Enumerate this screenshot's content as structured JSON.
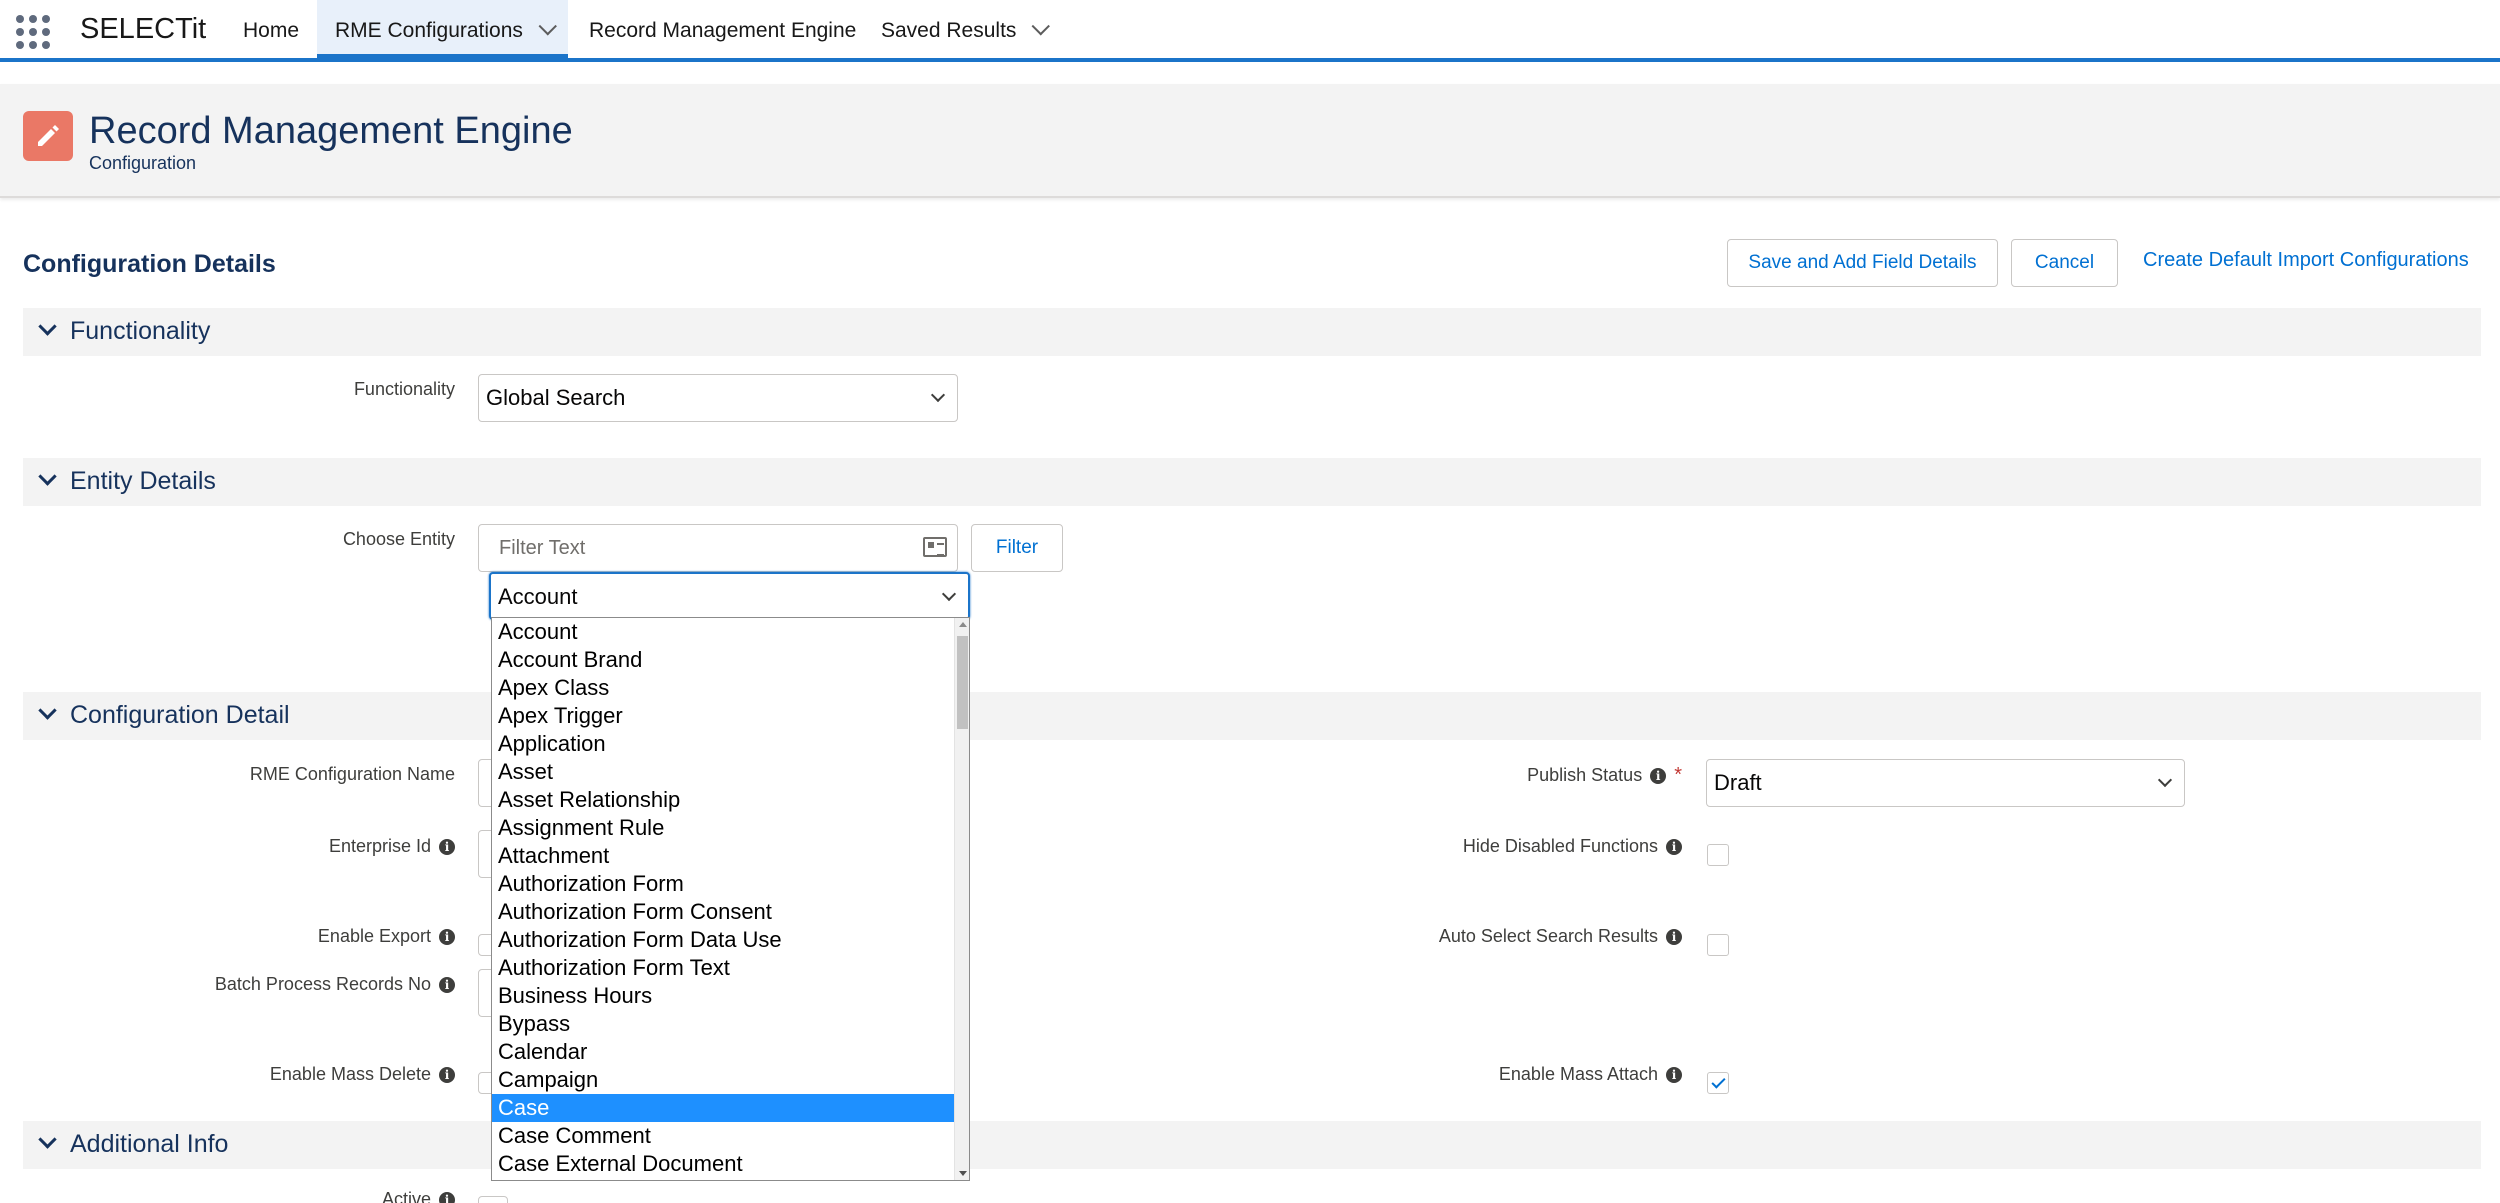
{
  "nav": {
    "app_name": "SELECTit",
    "items": [
      {
        "label": "Home"
      },
      {
        "label": "RME Configurations"
      },
      {
        "label": "Record Management Engine"
      },
      {
        "label": "Saved Results"
      }
    ]
  },
  "header": {
    "title": "Record Management Engine",
    "subtitle": "Configuration"
  },
  "card": {
    "title": "Configuration Details",
    "save_button": "Save and Add Field Details",
    "cancel_button": "Cancel",
    "default_import_link": "Create Default Import Configurations"
  },
  "sections": {
    "functionality": "Functionality",
    "entity_details": "Entity Details",
    "configuration_detail": "Configuration Detail",
    "additional_info": "Additional Info"
  },
  "fields": {
    "functionality_label": "Functionality",
    "functionality_value": "Global Search",
    "choose_entity_label": "Choose Entity",
    "filter_placeholder": "Filter Text",
    "filter_button": "Filter",
    "entity_value": "Account",
    "rme_config_name_label": "RME Configuration Name",
    "enterprise_id_label": "Enterprise Id",
    "enable_export_label": "Enable Export",
    "batch_process_label": "Batch Process Records No",
    "enable_mass_delete_label": "Enable Mass Delete",
    "publish_status_label": "Publish Status",
    "publish_status_value": "Draft",
    "hide_disabled_label": "Hide Disabled Functions",
    "hide_disabled_checked": false,
    "auto_select_label": "Auto Select Search Results",
    "auto_select_checked": false,
    "enable_mass_attach_label": "Enable Mass Attach",
    "enable_mass_attach_checked": true,
    "active_label": "Active"
  },
  "entity_options": [
    "Account",
    "Account Brand",
    "Apex Class",
    "Apex Trigger",
    "Application",
    "Asset",
    "Asset Relationship",
    "Assignment Rule",
    "Attachment",
    "Authorization Form",
    "Authorization Form Consent",
    "Authorization Form Data Use",
    "Authorization Form Text",
    "Business Hours",
    "Bypass",
    "Calendar",
    "Campaign",
    "Case",
    "Case Comment",
    "Case External Document"
  ],
  "entity_highlighted": "Case",
  "colors": {
    "brand": "#1b74c9",
    "header_icon": "#ea7866",
    "title_text": "#16325c",
    "link": "#0070d2",
    "highlight": "#1e90ff"
  }
}
